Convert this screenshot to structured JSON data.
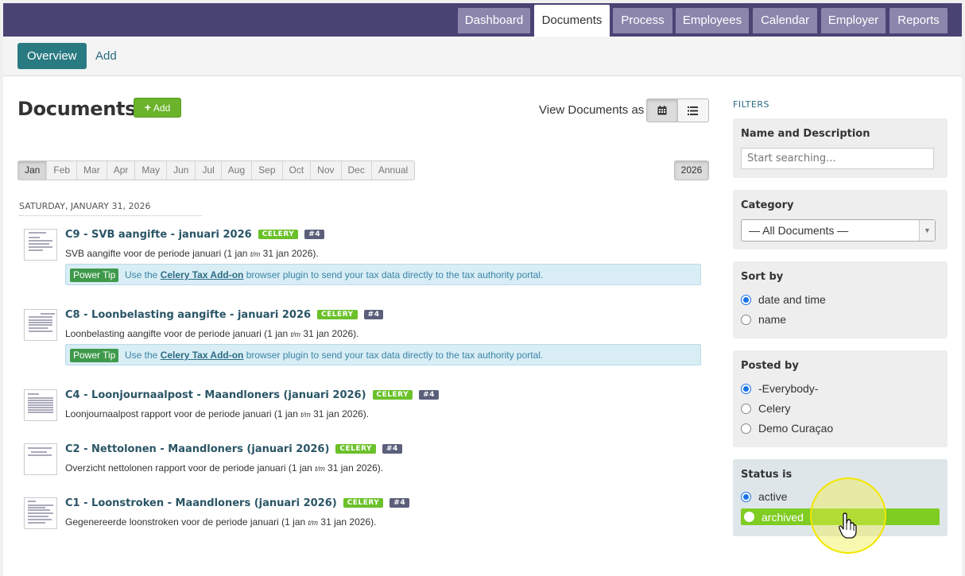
{
  "top_tabs": [
    {
      "label": "Dashboard"
    },
    {
      "label": "Documents",
      "active": true
    },
    {
      "label": "Process"
    },
    {
      "label": "Employees"
    },
    {
      "label": "Calendar"
    },
    {
      "label": "Employer"
    },
    {
      "label": "Reports"
    }
  ],
  "subnav": {
    "overview_label": "Overview",
    "add_label": "Add"
  },
  "page": {
    "title": "Documents",
    "add_button": "Add",
    "view_label": "View Documents as"
  },
  "months": [
    "Jan",
    "Feb",
    "Mar",
    "Apr",
    "May",
    "Jun",
    "Jul",
    "Aug",
    "Sep",
    "Oct",
    "Nov",
    "Dec",
    "Annual"
  ],
  "active_month": "Jan",
  "year": "2026",
  "day_header": "SATURDAY, JANUARY 31, 2026",
  "documents": [
    {
      "title": "C9 - SVB aangifte - januari 2026",
      "badge": "CELERY",
      "number": "#4",
      "desc_before": "SVB aangifte voor de periode januari (1 jan",
      "desc_mid": "t/m",
      "desc_after": "31 jan 2026).",
      "tip": true
    },
    {
      "title": "C8 - Loonbelasting aangifte - januari 2026",
      "badge": "CELERY",
      "number": "#4",
      "desc_before": "Loonbelasting aangifte voor de periode januari (1 jan",
      "desc_mid": "t/m",
      "desc_after": "31 jan 2026).",
      "tip": true
    },
    {
      "title": "C4 - Loonjournaalpost - Maandloners (januari 2026)",
      "badge": "CELERY",
      "number": "#4",
      "desc_before": "Loonjournaalpost rapport voor de periode januari (1 jan",
      "desc_mid": "t/m",
      "desc_after": "31 jan 2026).",
      "tip": false
    },
    {
      "title": "C2 - Nettolonen - Maandloners (januari 2026)",
      "badge": "CELERY",
      "number": "#4",
      "desc_before": "Overzicht nettolonen rapport voor de periode januari (1 jan",
      "desc_mid": "t/m",
      "desc_after": "31 jan 2026).",
      "tip": false
    },
    {
      "title": "C1 - Loonstroken - Maandloners (januari 2026)",
      "badge": "CELERY",
      "number": "#4",
      "desc_before": "Gegenereerde loonstroken voor de periode januari (1 jan",
      "desc_mid": "t/m",
      "desc_after": "31 jan 2026).",
      "tip": false
    }
  ],
  "power_tip": {
    "label": "Power Tip",
    "text_before": "Use the",
    "link": "Celery Tax Add-on",
    "text_after": "browser plugin to send your tax data directly to the tax authority portal."
  },
  "filters": {
    "heading": "FILTERS",
    "name_desc": {
      "label": "Name and Description",
      "placeholder": "Start searching..."
    },
    "category": {
      "label": "Category",
      "selected": "— All Documents —"
    },
    "sort_by": {
      "label": "Sort by",
      "options": [
        "date and time",
        "name"
      ],
      "selected": "date and time"
    },
    "posted_by": {
      "label": "Posted by",
      "options": [
        "-Everybody-",
        "Celery",
        "Demo Curaçao"
      ],
      "selected": "-Everybody-"
    },
    "status": {
      "label": "Status is",
      "options": [
        "active",
        "archived"
      ],
      "selected": "active",
      "hovered": "archived"
    }
  },
  "colors": {
    "topbar": "#4a4475",
    "accent_teal": "#2a7a82",
    "celery_green": "#6bc12a",
    "hover_green": "#7fcc22"
  }
}
